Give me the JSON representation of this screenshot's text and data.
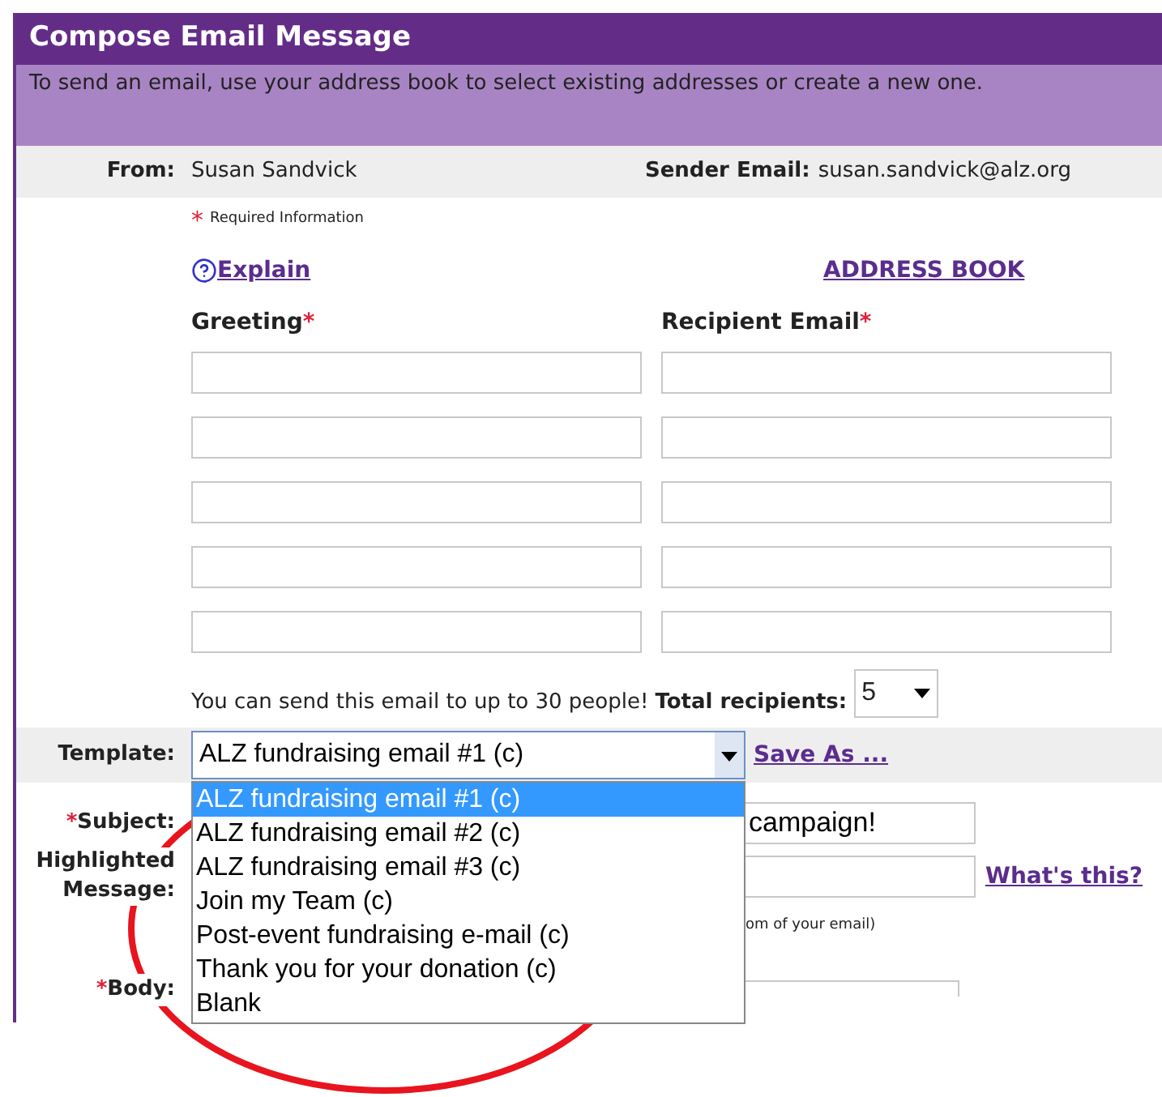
{
  "header": {
    "title": "Compose Email Message",
    "description": "To send an email, use your address book to select existing addresses or create a new one."
  },
  "from": {
    "label": "From:",
    "value": "Susan Sandvick",
    "sender_label": "Sender Email:",
    "sender_value": "susan.sandvick@alz.org"
  },
  "required_note": {
    "mark": "*",
    "text": "Required Information"
  },
  "explain_link": "Explain",
  "address_book_link": "ADDRESS BOOK",
  "columns": [
    {
      "label": "Greeting",
      "mark": "*"
    },
    {
      "label": "Recipient Email",
      "mark": "*"
    }
  ],
  "recipient_rows": [
    {
      "greeting": "",
      "email": ""
    },
    {
      "greeting": "",
      "email": ""
    },
    {
      "greeting": "",
      "email": ""
    },
    {
      "greeting": "",
      "email": ""
    },
    {
      "greeting": "",
      "email": ""
    }
  ],
  "limit_text": "You can send this email to up to 30 people!",
  "total_label": "Total recipients:",
  "total_value": "5",
  "template": {
    "label": "Template:",
    "value": "ALZ fundraising email #1 (c)",
    "save_as": "Save As ...",
    "expanded": true,
    "options": [
      {
        "label": "ALZ fundraising email #1 (c)",
        "selected": true
      },
      {
        "label": "ALZ fundraising email #2 (c)",
        "selected": false
      },
      {
        "label": "ALZ fundraising email #3 (c)",
        "selected": false
      },
      {
        "label": "Join my Team (c)",
        "selected": false
      },
      {
        "label": "Post-event fundraising e-mail (c)",
        "selected": false
      },
      {
        "label": "Thank you for your donation (c)",
        "selected": false
      },
      {
        "label": "Blank",
        "selected": false
      }
    ]
  },
  "subject": {
    "mark": "*",
    "label": "Subject:",
    "value": "campaign!"
  },
  "highlighted": {
    "label": "Highlighted Message:",
    "link": "What's this?",
    "note": "om of your email)"
  },
  "body": {
    "mark": "*",
    "label": "Body:"
  }
}
